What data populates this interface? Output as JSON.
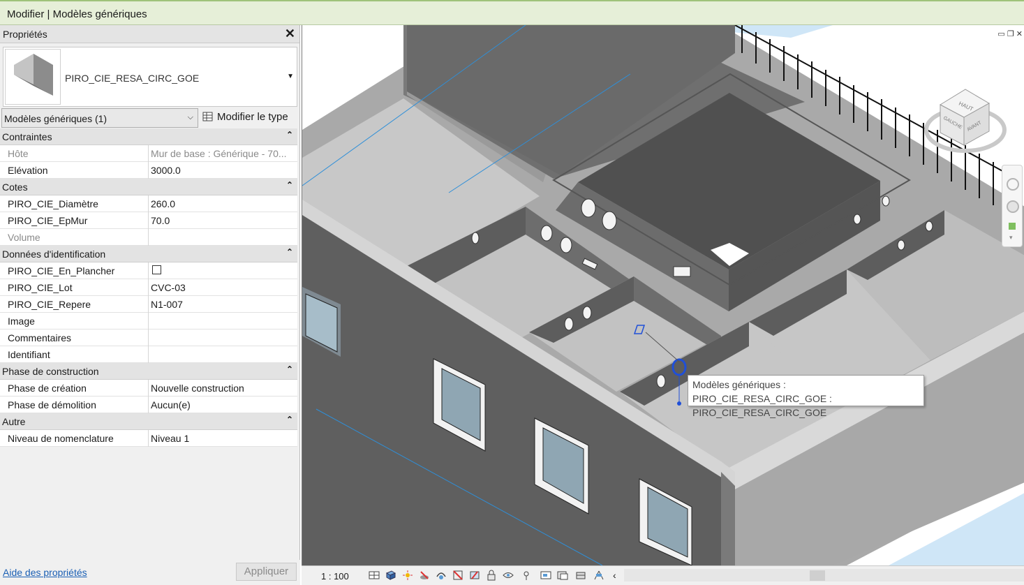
{
  "context_bar": {
    "title": "Modifier | Modèles génériques"
  },
  "properties": {
    "title": "Propriétés",
    "close_icon": "close-icon",
    "type_selector": {
      "name": "PIRO_CIE_RESA_CIRC_GOE"
    },
    "filter": {
      "value": "Modèles génériques (1)"
    },
    "edit_type_label": "Modifier le type",
    "sections": [
      {
        "label": "Contraintes",
        "rows": [
          {
            "key": "Hôte",
            "value": "Mur de base : Générique - 70...",
            "disabled": true
          },
          {
            "key": "Elévation",
            "value": "3000.0"
          }
        ]
      },
      {
        "label": "Cotes",
        "rows": [
          {
            "key": "PIRO_CIE_Diamètre",
            "value": "260.0"
          },
          {
            "key": "PIRO_CIE_EpMur",
            "value": "70.0"
          },
          {
            "key": "Volume",
            "value": "",
            "disabled": true
          }
        ]
      },
      {
        "label": "Données d'identification",
        "rows": [
          {
            "key": "PIRO_CIE_En_Plancher",
            "value": "",
            "checkbox": true
          },
          {
            "key": "PIRO_CIE_Lot",
            "value": "CVC-03"
          },
          {
            "key": "PIRO_CIE_Repere",
            "value": "N1-007"
          },
          {
            "key": "Image",
            "value": ""
          },
          {
            "key": "Commentaires",
            "value": ""
          },
          {
            "key": "Identifiant",
            "value": ""
          }
        ]
      },
      {
        "label": "Phase de construction",
        "rows": [
          {
            "key": "Phase de création",
            "value": "Nouvelle construction"
          },
          {
            "key": "Phase de démolition",
            "value": "Aucun(e)"
          }
        ]
      },
      {
        "label": "Autre",
        "rows": [
          {
            "key": "Niveau de nomenclature",
            "value": "Niveau 1"
          }
        ]
      }
    ],
    "help_link": "Aide des propriétés",
    "apply_button": "Appliquer"
  },
  "viewport": {
    "tooltip_line1": "Modèles génériques : PIRO_CIE_RESA_CIRC_GOE :",
    "tooltip_line2": "PIRO_CIE_RESA_CIRC_GOE",
    "viewcube": {
      "top": "HAUT",
      "left": "GAUCHE",
      "front": "AVANT"
    }
  },
  "view_control_bar": {
    "scale": "1 : 100"
  },
  "colors": {
    "context_bar": "#e6efd8",
    "wall_dark": "#606060",
    "slab": "#bdbdbd",
    "selection": "#1f4fd8"
  }
}
